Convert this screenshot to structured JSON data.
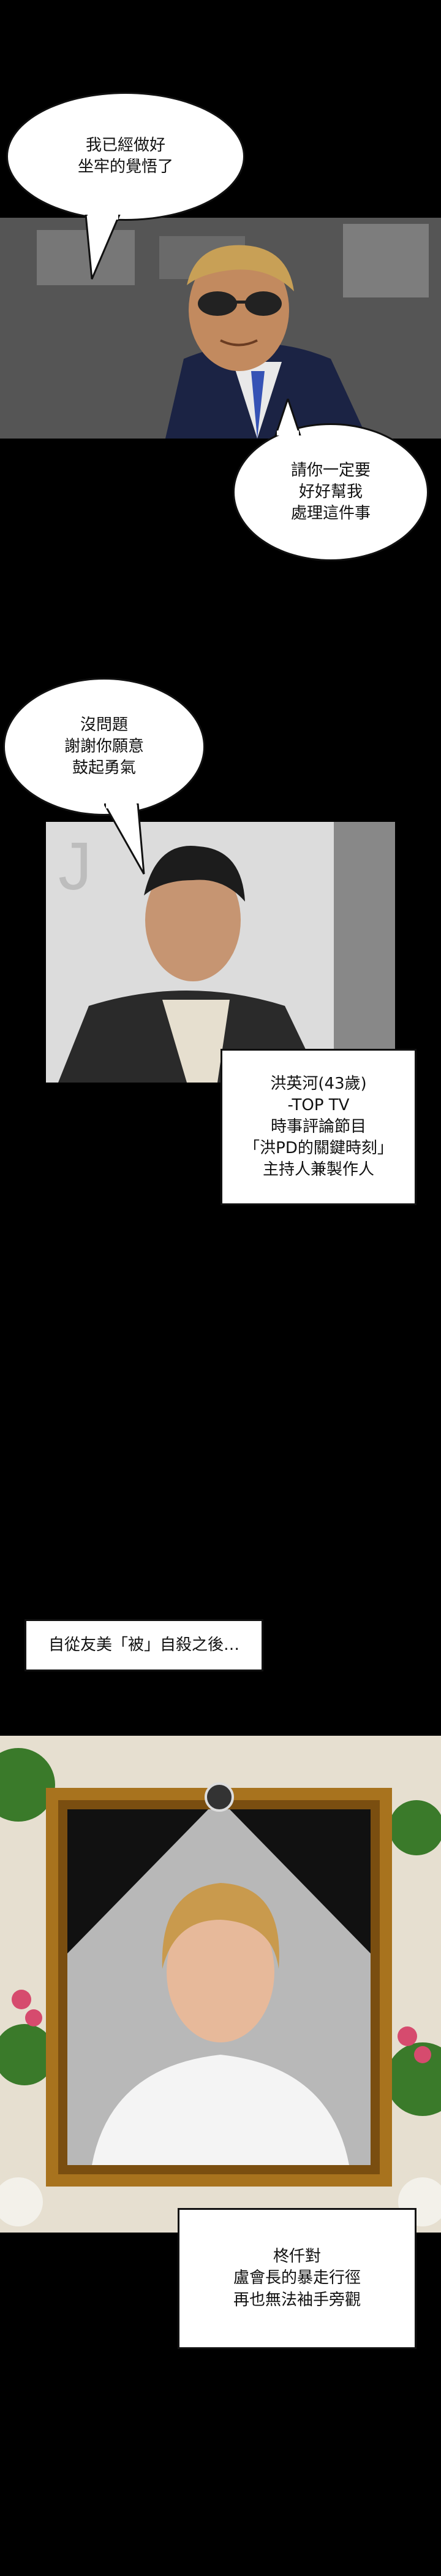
{
  "panels": {
    "office_man": {
      "bubble_lines": [
        "我已經做好",
        "坐牢的覺悟了"
      ]
    },
    "request": {
      "bubble_lines": [
        "請你一定要",
        "好好幫我",
        "處理這件事"
      ]
    },
    "reply": {
      "bubble_lines": [
        "沒問題",
        "謝謝你願意",
        "鼓起勇氣"
      ]
    },
    "producer_caption": {
      "lines": [
        "洪英河(43歲)",
        "-TOP TV",
        "時事評論節目",
        "「洪PD的關鍵時刻」",
        "主持人兼製作人"
      ]
    },
    "narration_1": {
      "text": "自從友美「被」自殺之後…"
    },
    "narration_2": {
      "lines": [
        "柊仟對",
        "盧會長的暴走行徑",
        "再也無法袖手旁觀"
      ]
    }
  },
  "colors": {
    "background": "#000000",
    "frame_gold": "#a8731e",
    "flower_pink": "#d64b6e",
    "leaf_green": "#3a7a2a"
  }
}
